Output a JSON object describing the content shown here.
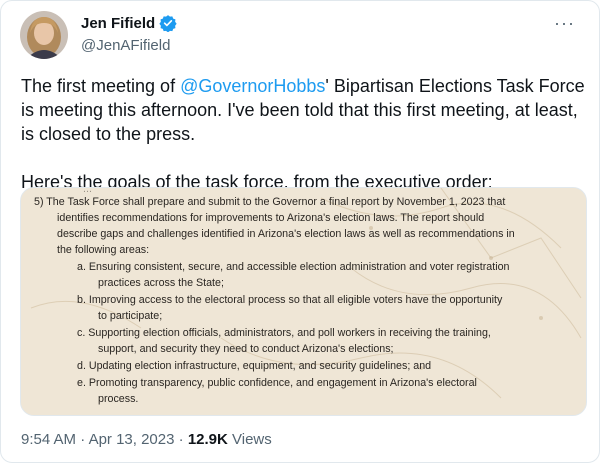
{
  "author": {
    "display_name": "Jen Fifield",
    "handle": "@JenAFifield",
    "avatar_icon": "avatar-photo",
    "verified_icon": "verified-badge-icon"
  },
  "more_label": "···",
  "tweet": {
    "line1_pre": "The first meeting of ",
    "mention": "@GovernorHobbs",
    "line1_post": "' Bipartisan Elections Task Force is meeting this afternoon. I've been told that this first meeting, at least, is closed to the press.",
    "para2": "Here's the goals of the task force, from the executive order:"
  },
  "document": {
    "top_fragment": "...",
    "lines": [
      "5)   The Task Force shall prepare and submit to the Governor a final report by November 1, 2023 that",
      "identifies recommendations for improvements to Arizona's election laws. The report should",
      "describe gaps and challenges identified in Arizona's election laws as well as recommendations in",
      "the following areas:",
      "a.   Ensuring consistent, secure, and accessible election administration and voter registration",
      "practices across the State;",
      "b.   Improving access to the electoral process so that all eligible voters have the opportunity",
      "to participate;",
      "c.   Supporting election officials, administrators, and poll workers in receiving the training,",
      "support, and security they need to conduct Arizona's elections;",
      "d.   Updating election infrastructure, equipment, and security guidelines; and",
      "e.   Promoting transparency, public confidence, and engagement in Arizona's electoral",
      "process."
    ]
  },
  "meta": {
    "time": "9:54 AM",
    "sep1": " · ",
    "date": "Apr 13, 2023",
    "sep2": " · ",
    "views_count": "12.9K",
    "views_label": " Views"
  },
  "colors": {
    "accent": "#1d9bf0",
    "text": "#0f1419",
    "secondary": "#536471",
    "doc_bg": "#efe6d6"
  }
}
